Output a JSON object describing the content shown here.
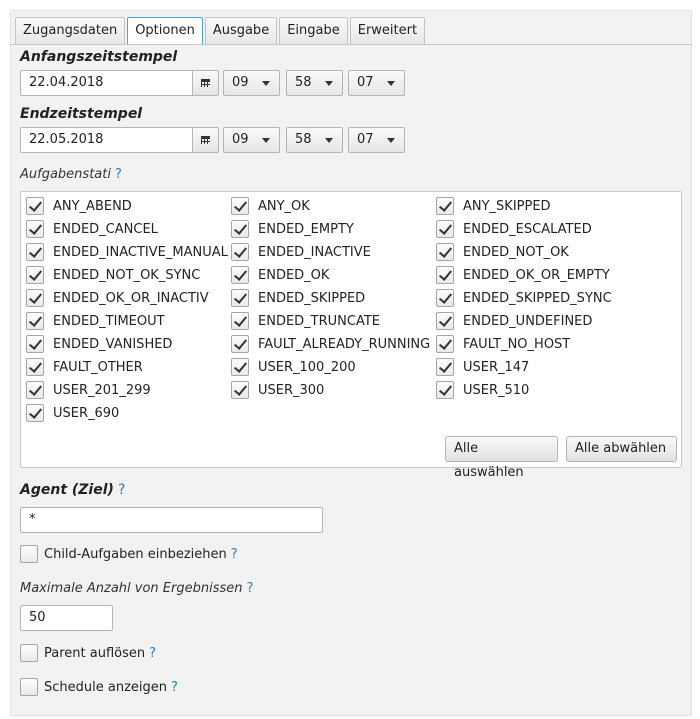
{
  "tabs": [
    {
      "label": "Zugangsdaten",
      "active": false
    },
    {
      "label": "Optionen",
      "active": true
    },
    {
      "label": "Ausgabe",
      "active": false
    },
    {
      "label": "Eingabe",
      "active": false
    },
    {
      "label": "Erweitert",
      "active": false
    }
  ],
  "start": {
    "label": "Anfangszeitstempel",
    "date": "22.04.2018",
    "hour": "09",
    "minute": "58",
    "second": "07"
  },
  "end": {
    "label": "Endzeitstempel",
    "date": "22.05.2018",
    "hour": "09",
    "minute": "58",
    "second": "07"
  },
  "statuses": {
    "label": "Aufgabenstati",
    "help": "?",
    "items": [
      {
        "label": "ANY_ABEND",
        "checked": true
      },
      {
        "label": "ANY_OK",
        "checked": true
      },
      {
        "label": "ANY_SKIPPED",
        "checked": true
      },
      {
        "label": "ENDED_CANCEL",
        "checked": true
      },
      {
        "label": "ENDED_EMPTY",
        "checked": true
      },
      {
        "label": "ENDED_ESCALATED",
        "checked": true
      },
      {
        "label": "ENDED_INACTIVE_MANUAL",
        "checked": true
      },
      {
        "label": "ENDED_INACTIVE",
        "checked": true
      },
      {
        "label": "ENDED_NOT_OK",
        "checked": true
      },
      {
        "label": "ENDED_NOT_OK_SYNC",
        "checked": true
      },
      {
        "label": "ENDED_OK",
        "checked": true
      },
      {
        "label": "ENDED_OK_OR_EMPTY",
        "checked": true
      },
      {
        "label": "ENDED_OK_OR_INACTIV",
        "checked": true
      },
      {
        "label": "ENDED_SKIPPED",
        "checked": true
      },
      {
        "label": "ENDED_SKIPPED_SYNC",
        "checked": true
      },
      {
        "label": "ENDED_TIMEOUT",
        "checked": true
      },
      {
        "label": "ENDED_TRUNCATE",
        "checked": true
      },
      {
        "label": "ENDED_UNDEFINED",
        "checked": true
      },
      {
        "label": "ENDED_VANISHED",
        "checked": true
      },
      {
        "label": "FAULT_ALREADY_RUNNING",
        "checked": true
      },
      {
        "label": "FAULT_NO_HOST",
        "checked": true
      },
      {
        "label": "FAULT_OTHER",
        "checked": true
      },
      {
        "label": "USER_100_200",
        "checked": true
      },
      {
        "label": "USER_147",
        "checked": true
      },
      {
        "label": "USER_201_299",
        "checked": true
      },
      {
        "label": "USER_300",
        "checked": true
      },
      {
        "label": "USER_510",
        "checked": true
      },
      {
        "label": "USER_690",
        "checked": true
      }
    ],
    "select_all_label": "Alle auswählen",
    "deselect_all_label": "Alle abwählen"
  },
  "agent": {
    "label": "Agent (Ziel)",
    "help": "?",
    "value": "*"
  },
  "child_tasks": {
    "label": "Child-Aufgaben einbeziehen",
    "help": "?",
    "checked": false
  },
  "max_results": {
    "label": "Maximale Anzahl von Ergebnissen",
    "help": "?",
    "value": "50"
  },
  "resolve_parent": {
    "label": "Parent auflösen",
    "help": "?",
    "checked": false
  },
  "show_schedule": {
    "label": "Schedule anzeigen",
    "help": "?",
    "checked": false
  }
}
